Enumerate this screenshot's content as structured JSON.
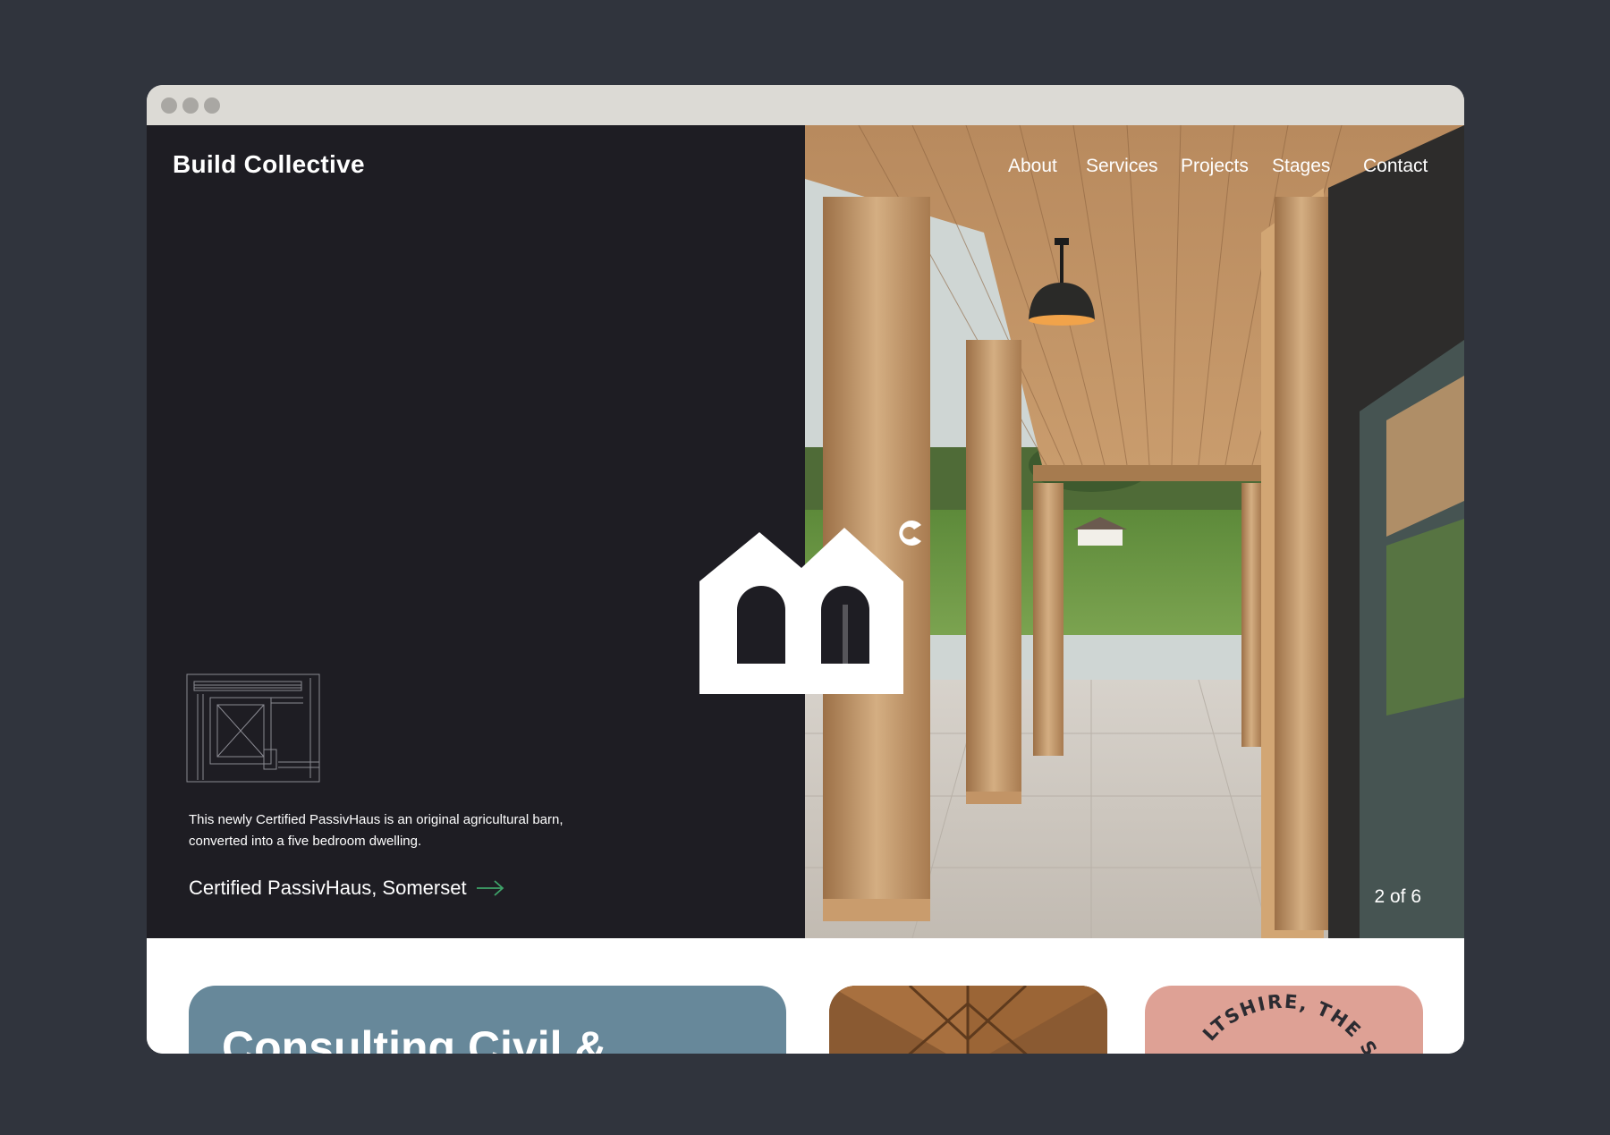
{
  "site": {
    "brand": "Build Collective"
  },
  "nav": {
    "items": [
      {
        "label": "About"
      },
      {
        "label": "Services"
      },
      {
        "label": "Projects"
      },
      {
        "label": "Stages"
      },
      {
        "label": "Contact"
      }
    ]
  },
  "hero": {
    "caption": "This newly Certified PassivHaus is an original agricultural barn, converted into a five bedroom dwelling.",
    "project_title": "Certified PassivHaus, Somerset",
    "slide_counter": "2 of 6"
  },
  "cards": {
    "consulting_title": "Consulting Civil &",
    "badge_text": "LTSHIRE, THE SOU"
  },
  "colors": {
    "page_bg": "#30343d",
    "hero_dark": "#1e1d23",
    "card_blue": "#67889a",
    "card_pink": "#dea195",
    "arrow_accent": "#3fa46a"
  }
}
